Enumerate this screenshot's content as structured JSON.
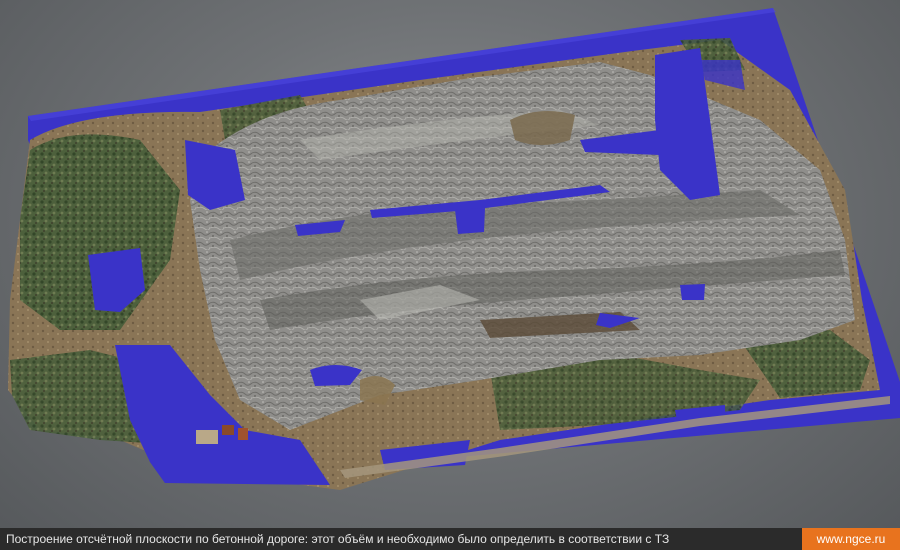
{
  "caption": {
    "text": "Построение отсчётной плоскости по бетонной дороге: этот объём и необходимо было определить в соответствии с ТЗ",
    "website": "www.ngce.ru"
  },
  "colors": {
    "reference_plane": "#3a33c8",
    "terrain_rock": "#8d8c89",
    "vegetation": "#3f5a33",
    "soil": "#8a7556",
    "caption_background": "#2b2b2b",
    "brand_badge": "#e8731e"
  }
}
